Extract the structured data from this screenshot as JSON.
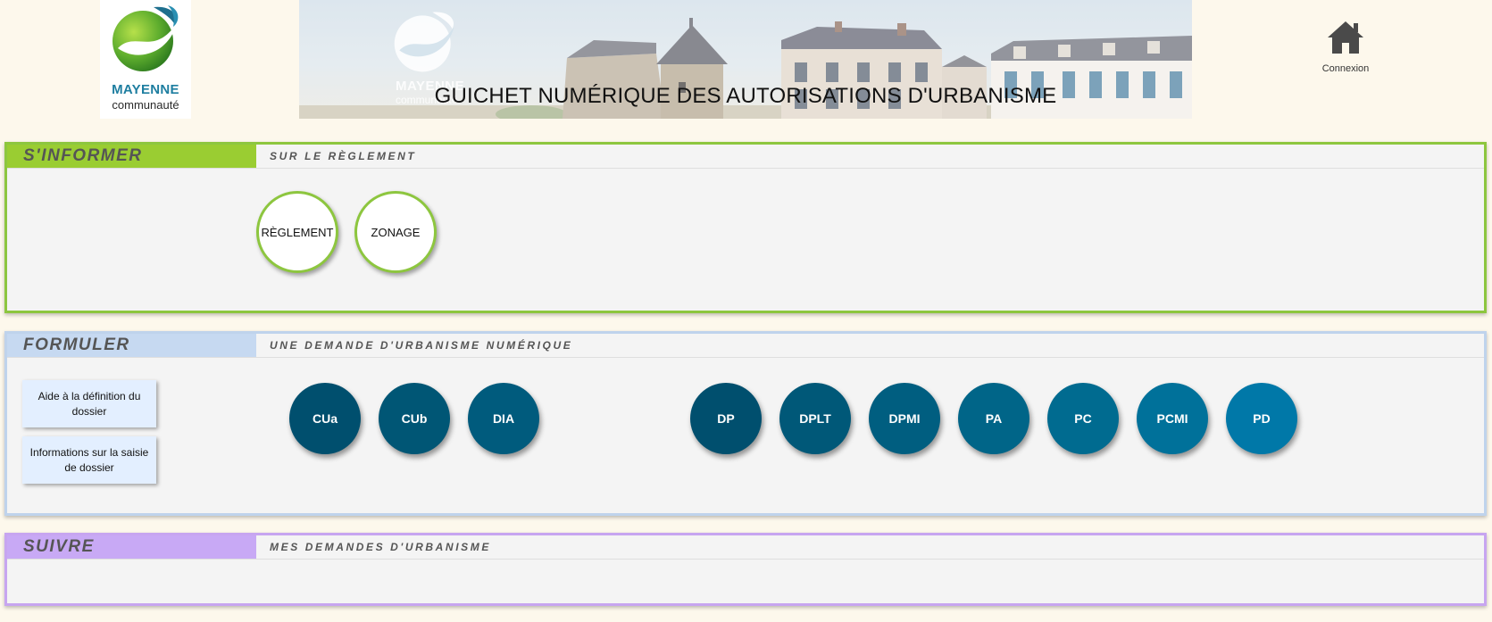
{
  "header": {
    "logo_title": "MAYENNE",
    "logo_subtitle": "communauté",
    "banner_logo_title": "MAYENNE",
    "banner_logo_subtitle": "communauté",
    "title": "GUICHET NUMÉRIQUE DES AUTORISATIONS D'URBANISME",
    "login_label": "Connexion"
  },
  "sections": {
    "informer": {
      "tab": "S'INFORMER",
      "subtitle": "SUR LE RÈGLEMENT",
      "buttons": [
        "RÈGLEMENT",
        "ZONAGE"
      ]
    },
    "formuler": {
      "tab": "FORMULER",
      "subtitle": "UNE DEMANDE D'URBANISME NUMÉRIQUE",
      "help_buttons": [
        "Aide à la définition du dossier",
        "Informations sur la saisie de dossier"
      ],
      "demand_buttons": [
        "CUa",
        "CUb",
        "DIA",
        "DP",
        "DPLT",
        "DPMI",
        "PA",
        "PC",
        "PCMI",
        "PD"
      ]
    },
    "suivre": {
      "tab": "SUIVRE",
      "subtitle": "MES DEMANDES D'URBANISME"
    }
  },
  "colors": {
    "informer_accent": "#8dc63f",
    "formuler_accent": "#c6d9f1",
    "suivre_accent": "#c8a9f5",
    "demand_dark": "#004f6e",
    "demand_light": "#0078a8"
  },
  "icons": {
    "login": "home-icon"
  }
}
